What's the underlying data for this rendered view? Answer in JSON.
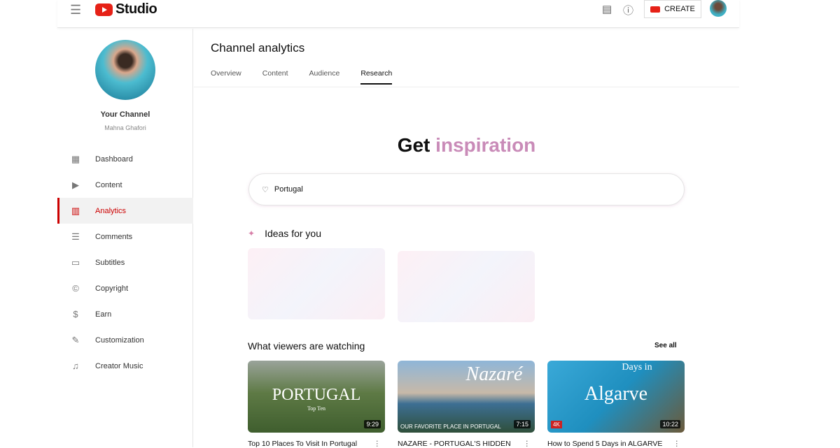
{
  "header": {
    "logo_text": "Studio",
    "create_label": "CREATE"
  },
  "channel": {
    "name": "Your Channel",
    "owner": "Mahna Ghafori"
  },
  "sidebar": {
    "items": [
      {
        "label": "Dashboard",
        "icon": "dashboard-icon",
        "glyph": "▦"
      },
      {
        "label": "Content",
        "icon": "content-icon",
        "glyph": "▶"
      },
      {
        "label": "Analytics",
        "icon": "analytics-icon",
        "glyph": "▥"
      },
      {
        "label": "Comments",
        "icon": "comments-icon",
        "glyph": "☰"
      },
      {
        "label": "Subtitles",
        "icon": "subtitles-icon",
        "glyph": "▭"
      },
      {
        "label": "Copyright",
        "icon": "copyright-icon",
        "glyph": "©"
      },
      {
        "label": "Earn",
        "icon": "earn-icon",
        "glyph": "$"
      },
      {
        "label": "Customization",
        "icon": "customization-icon",
        "glyph": "✎"
      },
      {
        "label": "Creator Music",
        "icon": "music-icon",
        "glyph": "♫"
      }
    ],
    "active": "Analytics"
  },
  "main": {
    "title": "Channel analytics",
    "tabs": [
      "Overview",
      "Content",
      "Audience",
      "Research"
    ],
    "active_tab": "Research",
    "hero": {
      "plain": "Get",
      "gradient": "inspiration"
    },
    "search_value": "Portugal",
    "ideas_label": "Ideas for you",
    "watching_label": "What viewers are watching",
    "see_all": "See all",
    "videos": [
      {
        "title": "Top 10 Places To Visit In Portugal",
        "duration": "9:29",
        "thumb_text": "PORTUGAL",
        "thumb_sub": "Top Ten"
      },
      {
        "title": "NAZARE - PORTUGAL'S HIDDEN",
        "duration": "7:15",
        "thumb_text": "Nazaré",
        "thumb_sub": "OUR FAVORITE PLACE IN PORTUGAL"
      },
      {
        "title": "How to Spend 5 Days in ALGARVE",
        "duration": "10:22",
        "thumb_text": "Algarve",
        "thumb_sub": "Days in",
        "badge": "4K"
      }
    ]
  },
  "colors": {
    "accent": "#cc0000",
    "gradient_text": "#c98bb8"
  }
}
